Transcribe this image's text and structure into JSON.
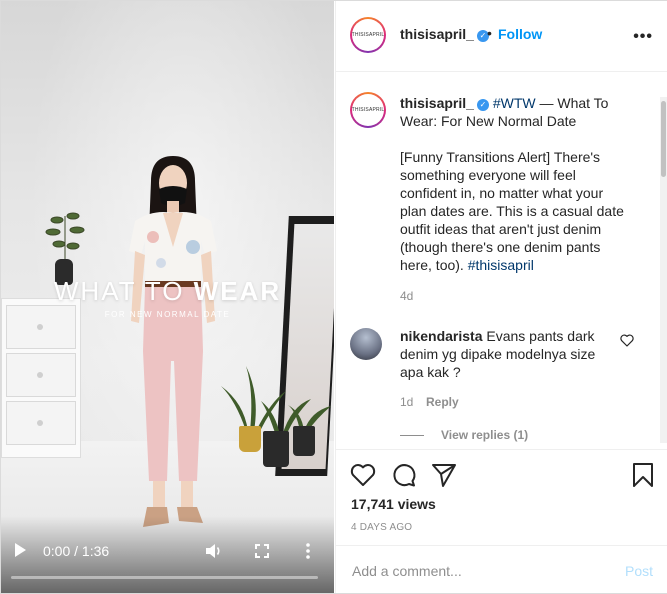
{
  "account": {
    "username": "thisisapril_",
    "avatar_text": "THISISAPRIL",
    "verified_mark": "✓",
    "dot": "•",
    "follow_label": "Follow",
    "more_label": "•••"
  },
  "video": {
    "overlay_title_light": "WHAT TO",
    "overlay_title_bold": "WEAR",
    "overlay_subtitle": "FOR NEW NORMAL DATE",
    "time": "0:00 / 1:36",
    "progress": 0
  },
  "caption": {
    "hashtag": "#WTW",
    "title_rest": " — What To Wear: For New Normal Date",
    "body": "[Funny Transitions Alert] There's something everyone will feel confident in, no matter what your plan dates are. This is a casual date outfit ideas that aren't just denim (though there's one denim pants here, too). ",
    "end_tag": "#thisisapril",
    "age": "4d"
  },
  "comment": {
    "username": "nikendarista",
    "text": " Evans pants dark denim yg dipake modelnya size apa kak ?",
    "age": "1d",
    "reply_label": "Reply",
    "view_replies": "View replies (1)"
  },
  "stats": {
    "views": "17,741 views",
    "date": "4 DAYS AGO"
  },
  "add_comment": {
    "placeholder": "Add a comment...",
    "post_label": "Post"
  },
  "colors": {
    "link": "#0095f6",
    "hashtag": "#00376b",
    "muted": "#8e8e8e",
    "post_disabled": "#b2dffc"
  }
}
